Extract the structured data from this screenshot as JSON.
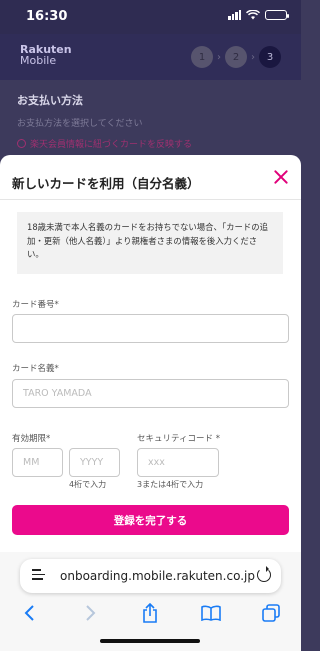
{
  "status": {
    "time": "16:30"
  },
  "background": {
    "logo_line1": "Rakuten",
    "logo_line2": "Mobile",
    "steps": [
      "1",
      "2",
      "3"
    ],
    "section_title": "お支払い方法",
    "section_sub": "お支払方法を選択してください",
    "link": "楽天会員情報に紐づくカードを反映する"
  },
  "modal": {
    "title": "新しいカードを利用（自分名義）",
    "notice": "18歳未満で本人名義のカードをお持ちでない場合、「カードの追加・更新（他人名義）」より親権者さまの情報を後入力ください。",
    "card_number_label": "カード番号*",
    "card_number_value": "",
    "card_name_label": "カード名義*",
    "card_name_placeholder": "TARO YAMADA",
    "expiry_label": "有効期限*",
    "expiry_month_placeholder": "MM",
    "expiry_year_placeholder": "YYYY",
    "expiry_hint": "4桁で入力",
    "cvc_label": "セキュリティコード *",
    "cvc_placeholder": "xxx",
    "cvc_hint": "3または4桁で入力",
    "submit_label": "登録を完了する"
  },
  "browser": {
    "url": "onboarding.mobile.rakuten.co.jp",
    "toolbar_icons": [
      "back-icon",
      "forward-icon",
      "share-icon",
      "bookmarks-icon",
      "tabs-icon"
    ]
  },
  "colors": {
    "accent": "#eb0a8c",
    "brand_dark": "#2f2c52",
    "ios_blue": "#1a7cf5"
  }
}
